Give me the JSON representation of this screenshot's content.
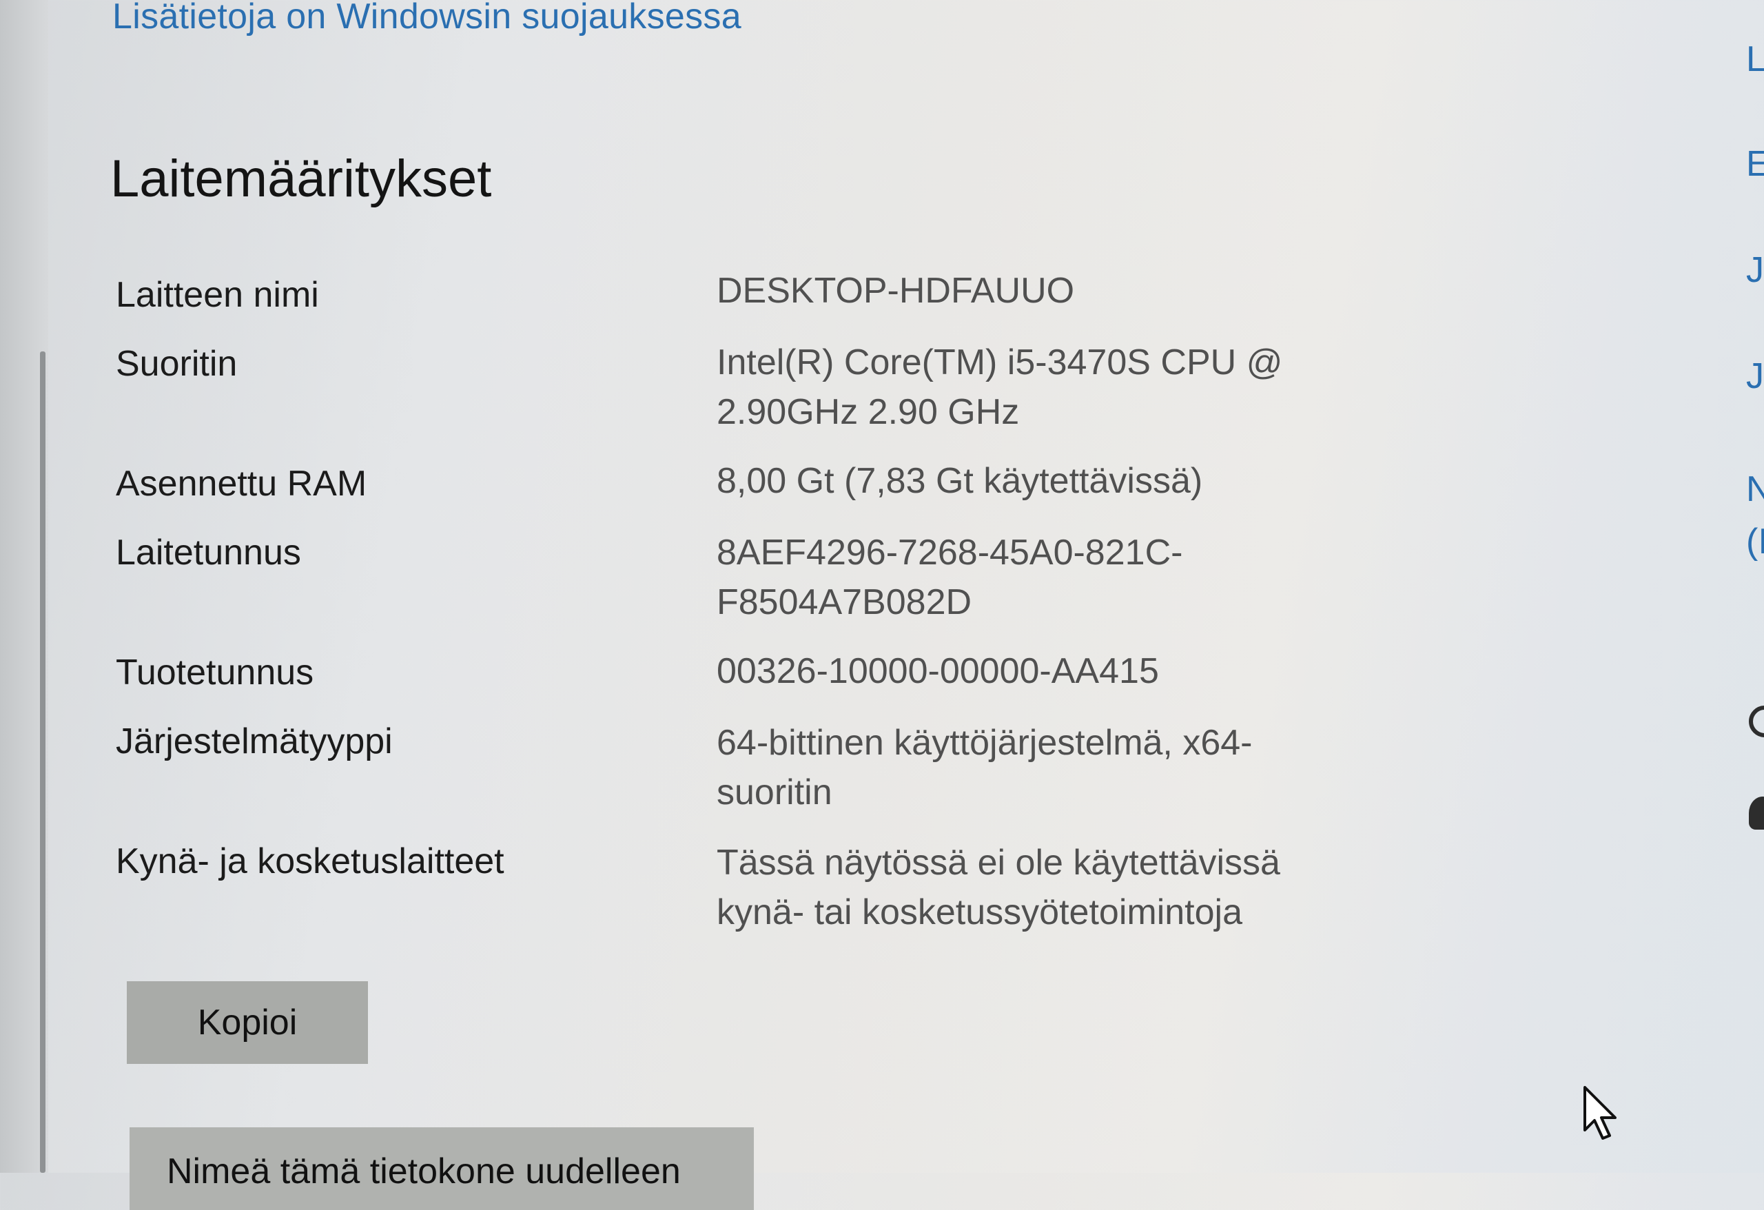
{
  "security_link": "Lisätietoja on Windowsin suojauksessa",
  "section_title": "Laitemääritykset",
  "specs": [
    {
      "label": "Laitteen nimi",
      "value": "DESKTOP-HDFAUUO"
    },
    {
      "label": "Suoritin",
      "value": "Intel(R) Core(TM) i5-3470S CPU @ 2.90GHz   2.90 GHz"
    },
    {
      "label": "Asennettu RAM",
      "value": "8,00 Gt (7,83 Gt käytettävissä)"
    },
    {
      "label": "Laitetunnus",
      "value": "8AEF4296-7268-45A0-821C-F8504A7B082D"
    },
    {
      "label": "Tuotetunnus",
      "value": "00326-10000-00000-AA415"
    },
    {
      "label": "Järjestelmätyyppi",
      "value": "64-bittinen käyttöjärjestelmä, x64-suoritin"
    },
    {
      "label": "Kynä- ja kosketuslaitteet",
      "value": "Tässä näytössä ei ole käytettävissä kynä- tai kosketussyötetoimintoja"
    }
  ],
  "buttons": {
    "copy": "Kopioi",
    "rename": "Nimeä tämä tietokone uudelleen"
  },
  "right_panel": {
    "links_partial": [
      "L",
      "E",
      "J",
      "J",
      "N",
      "(I"
    ],
    "icons": [
      "help-icon",
      "feedback-person-icon"
    ]
  },
  "colors": {
    "link": "#2a6fb1",
    "label_text": "#1b1b1b",
    "value_text": "#505050",
    "button_bg": "#a9aba8"
  }
}
